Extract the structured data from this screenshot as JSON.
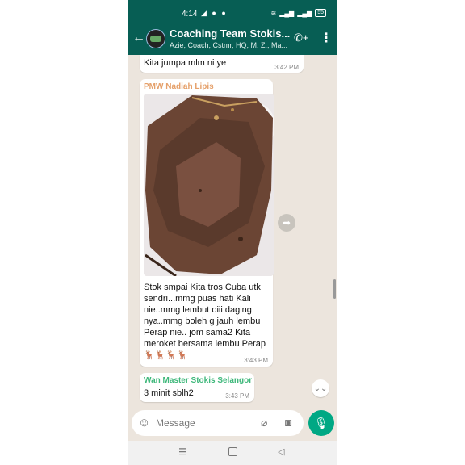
{
  "status_bar": {
    "time": "4:14",
    "left_icons": "◢ ● ●",
    "battery": "55"
  },
  "header": {
    "title": "Coaching Team Stokis...",
    "members": "Azie, Coach, Cstmr, HQ, M. Z., Ma..."
  },
  "messages": [
    {
      "text": "Kita jumpa mlm ni ye",
      "time": "3:42 PM"
    },
    {
      "sender": "PMW Nadiah Lipis",
      "sender_color": "#e5a06a",
      "image_description_icon": "photo-beef-slices",
      "text": "Stok smpai Kita tros Cuba utk sendri...mmg puas hati Kali nie..mmg lembut oiii daging nya..mmg boleh g jauh lembu Perap nie.. jom sama2 Kita meroket bersama lembu Perap",
      "emoji": "🦌🦌🦌🦌",
      "time": "3:43 PM"
    },
    {
      "sender": "Wan Master Stokis Selangor",
      "sender_color": "#3fb87b",
      "text": "3 minit sblh2",
      "time": "3:43 PM"
    }
  ],
  "composer": {
    "placeholder": "Message"
  },
  "colors": {
    "header": "#075e54",
    "chat_bg": "#ece5dd",
    "mic": "#00a884"
  }
}
